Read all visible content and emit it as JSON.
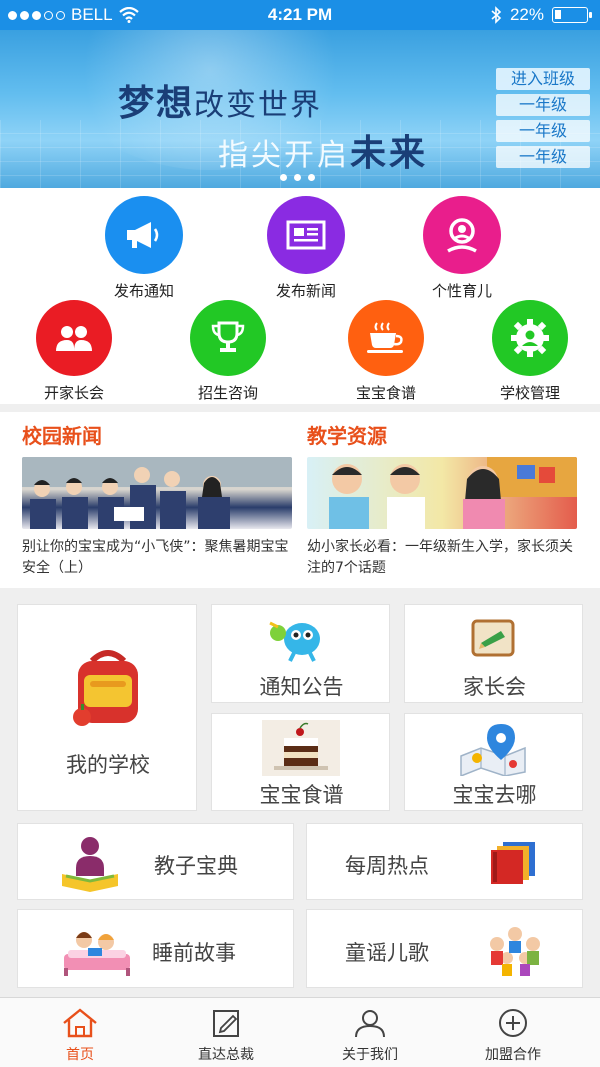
{
  "status_bar": {
    "carrier": "BELL",
    "time": "4:21 PM",
    "battery": "22%",
    "battery_level": 0.22
  },
  "banner": {
    "line1_big": "梦想",
    "line1_small": "改变世界",
    "line2_small": "指尖开启",
    "line2_big": "未来",
    "class_header": "进入班级",
    "classes": [
      "一年级",
      "一年级",
      "一年级"
    ]
  },
  "quick_actions": [
    {
      "label": "发布通知",
      "color": "#1a8ff0",
      "icon": "megaphone-icon"
    },
    {
      "label": "发布新闻",
      "color": "#8a2be2",
      "icon": "newspaper-icon"
    },
    {
      "label": "个性育儿",
      "color": "#e91e8c",
      "icon": "person-icon"
    },
    {
      "label": "开家长会",
      "color": "#ea1c24",
      "icon": "parents-icon"
    },
    {
      "label": "招生咨询",
      "color": "#22c825",
      "icon": "trophy-icon"
    },
    {
      "label": "宝宝食谱",
      "color": "#ff6010",
      "icon": "coffee-cup-icon"
    },
    {
      "label": "学校管理",
      "color": "#22c825",
      "icon": "gear-person-icon"
    }
  ],
  "news": {
    "campus_title": "校园新闻",
    "campus_caption": "别让你的宝宝成为“小飞侠”：聚焦暑期宝宝安全（上）",
    "resource_title": "教学资源",
    "resource_caption": "幼小家长必看：一年级新生入学，家长须关注的7个话题"
  },
  "tiles": {
    "my_school": "我的学校",
    "notice": "通知公告",
    "parent_meeting": "家长会",
    "baby_recipe": "宝宝食谱",
    "baby_where": "宝宝去哪",
    "parenting_guide": "教子宝典",
    "weekly_hot": "每周热点",
    "bedtime_story": "睡前故事",
    "nursery_rhymes": "童谣儿歌"
  },
  "bottom_nav": [
    {
      "label": "首页",
      "icon": "home-icon",
      "active": true
    },
    {
      "label": "直达总裁",
      "icon": "edit-icon",
      "active": false
    },
    {
      "label": "关于我们",
      "icon": "user-icon",
      "active": false
    },
    {
      "label": "加盟合作",
      "icon": "plus-circle-icon",
      "active": false
    }
  ],
  "colors": {
    "accent": "#e8501b",
    "status_bar": "#1b8fe6"
  }
}
